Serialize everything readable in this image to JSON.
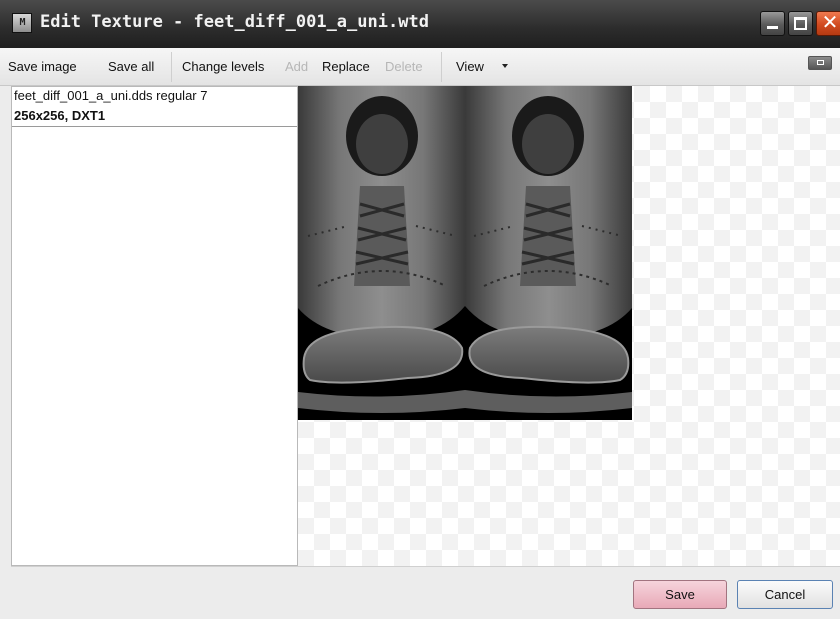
{
  "window": {
    "title": "Edit Texture - feet_diff_001_a_uni.wtd",
    "app_icon_text": "M"
  },
  "toolbar": {
    "save_image": "Save image",
    "save_all": "Save all",
    "change_levels": "Change levels",
    "add": "Add",
    "replace": "Replace",
    "delete": "Delete",
    "view": "View"
  },
  "texture_list": {
    "items": [
      {
        "name": "feet_diff_001_a_uni.dds regular 7",
        "info": "256x256, DXT1"
      }
    ]
  },
  "footer": {
    "save": "Save",
    "cancel": "Cancel"
  },
  "colors": {
    "titlebar": "#2c2c2c",
    "close_button": "#d14a1f",
    "save_button": "#e8a9b7",
    "texture_background": "#000000"
  }
}
